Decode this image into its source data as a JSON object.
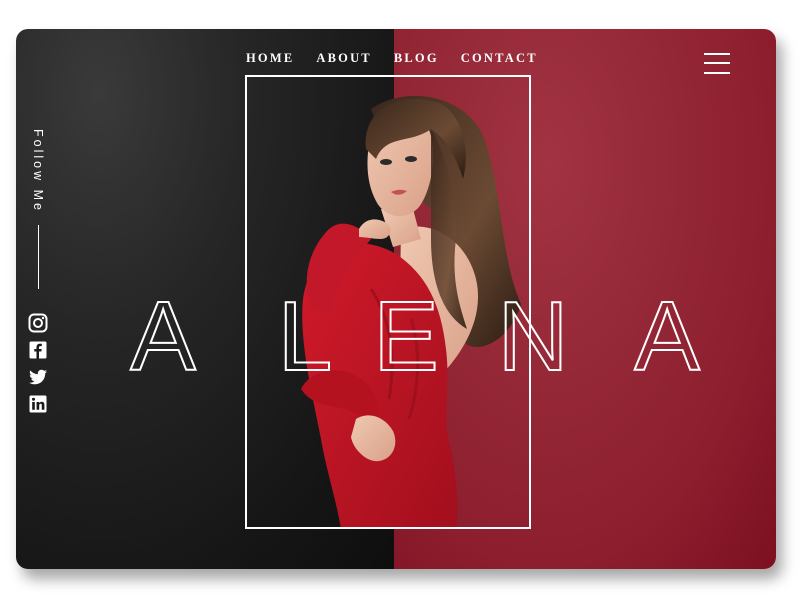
{
  "nav": {
    "items": [
      "HOME",
      "ABOUT",
      "BLOG",
      "CONTACT"
    ]
  },
  "sidebar": {
    "follow_label": "Follow Me",
    "socials": [
      "instagram-icon",
      "facebook-icon",
      "twitter-icon",
      "linkedin-icon"
    ]
  },
  "hero": {
    "letters": [
      "A",
      "L",
      "E",
      "N",
      "A"
    ]
  },
  "colors": {
    "dark_panel": "#1a1a1a",
    "accent_red": "#8c1e2e",
    "text": "#ffffff"
  },
  "icons": {
    "menu": "hamburger-menu-icon"
  }
}
